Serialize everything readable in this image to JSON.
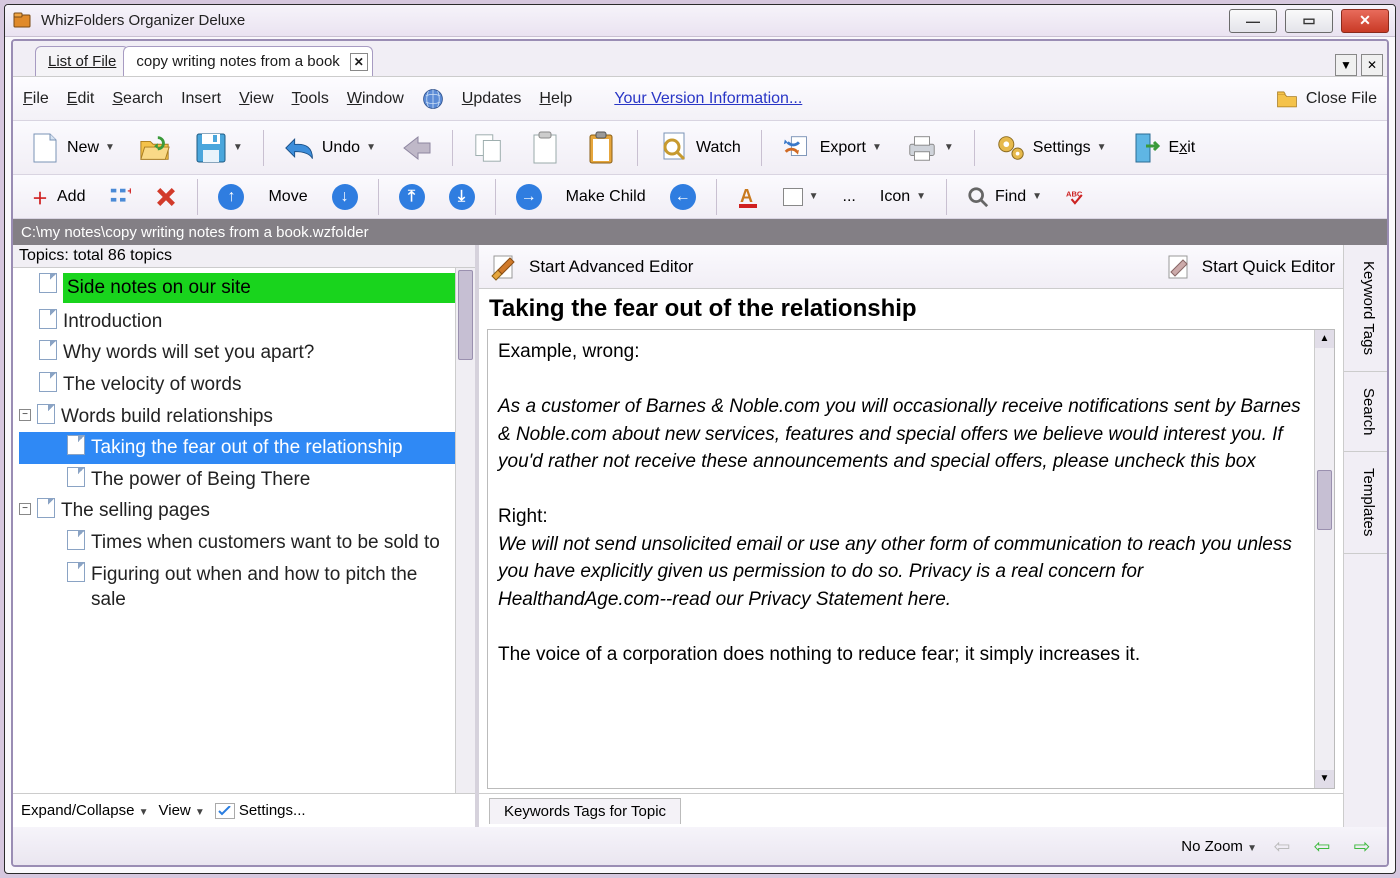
{
  "app": {
    "title": "WhizFolders Organizer Deluxe"
  },
  "doc_tabs": {
    "inactive": "List of File",
    "active": "copy writing notes from a book"
  },
  "menu": {
    "file": "File",
    "edit": "Edit",
    "search": "Search",
    "insert": "Insert",
    "view": "View",
    "tools": "Tools",
    "window": "Window",
    "updates": "Updates",
    "help": "Help",
    "version_link": "Your Version Information...",
    "close_file": "Close File"
  },
  "tb1": {
    "new": "New",
    "undo": "Undo",
    "watch": "Watch",
    "export": "Export",
    "settings": "Settings",
    "exit": "Exit"
  },
  "tb2": {
    "add": "Add",
    "move": "Move",
    "make_child": "Make Child",
    "icon": "Icon",
    "find": "Find",
    "ellipsis": "..."
  },
  "pathbar": "C:\\my notes\\copy writing notes from a book.wzfolder",
  "tree": {
    "header": "Topics: total 86 topics",
    "items": {
      "side_notes": "Side notes on our site",
      "introduction": "Introduction",
      "why_words": "Why words will set you apart?",
      "velocity": "The velocity of words",
      "words_build": "Words build relationships",
      "taking_fear": "Taking the fear out of the relationship",
      "power_being": "The power of Being There",
      "selling_pages": "The selling pages",
      "times_customers": "Times when customers want to be sold to",
      "figuring_out": "Figuring out when and how to pitch the sale"
    },
    "footer": {
      "expand": "Expand/Collapse",
      "view": "View",
      "settings": "Settings..."
    }
  },
  "editor": {
    "advanced": "Start Advanced Editor",
    "quick": "Start Quick Editor",
    "title": "Taking the fear out of the relationship",
    "p1": "Example, wrong:",
    "p2": "As a customer of Barnes & Noble.com you will occasionally receive notifications sent by Barnes & Noble.com about new services, features and special offers we believe would interest you. If you'd rather not receive these announcements and special offers, please uncheck this box",
    "p3": "Right:",
    "p4": "We will not send unsolicited email or use any other form of communication to reach you unless you have explicitly given us permission to do so. Privacy is a real concern for HealthandAge.com--read our Privacy Statement here.",
    "p5": "The voice of a corporation does nothing to reduce fear; it simply increases it.",
    "keywords_tab": "Keywords Tags for Topic"
  },
  "side_tabs": {
    "keyword": "Keyword Tags",
    "search": "Search",
    "templates": "Templates"
  },
  "status": {
    "zoom": "No Zoom"
  }
}
